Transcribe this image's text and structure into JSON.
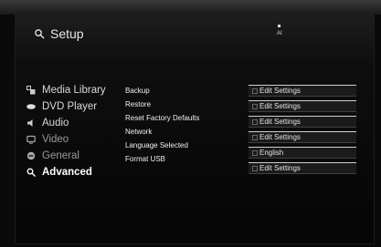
{
  "header": {
    "title": "Setup",
    "title_icon": "settings-icon",
    "status_text": "AI"
  },
  "sidebar": {
    "items": [
      {
        "label": "Media Library",
        "icon": "media-library-icon"
      },
      {
        "label": "DVD Player",
        "icon": "disc-icon"
      },
      {
        "label": "Audio",
        "icon": "speaker-icon"
      },
      {
        "label": "Video",
        "icon": "monitor-icon"
      },
      {
        "label": "General",
        "icon": "general-icon"
      },
      {
        "label": "Advanced",
        "icon": "advanced-icon",
        "selected": true
      }
    ]
  },
  "options": {
    "rows": [
      {
        "label": "Backup",
        "value": "Edit Settings"
      },
      {
        "label": "Restore",
        "value": "Edit Settings"
      },
      {
        "label": "Reset Factory Defaults",
        "value": "Edit Settings"
      },
      {
        "label": "Network",
        "value": "Edit Settings"
      },
      {
        "label": "Language Selected",
        "value": "English"
      },
      {
        "label": "Format USB",
        "value": "Edit Settings"
      }
    ]
  },
  "colors": {
    "background": "#0a0a0a",
    "text": "#e8e8e8",
    "dim_text": "#9a9a9a",
    "value_border": "#cfcfcf"
  }
}
